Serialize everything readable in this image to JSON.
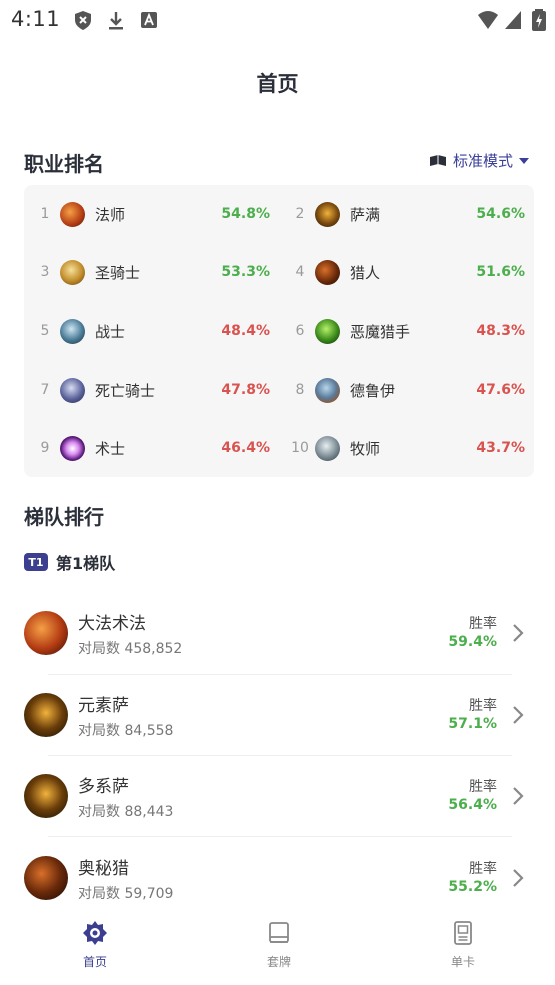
{
  "status_bar": {
    "time": "4:11"
  },
  "header": {
    "title": "首页"
  },
  "class_ranking": {
    "title": "职业排名",
    "mode_label": "标准模式",
    "items": [
      {
        "rank": "1",
        "name": "法师",
        "win_rate": "54.8%",
        "trend": "green"
      },
      {
        "rank": "2",
        "name": "萨满",
        "win_rate": "54.6%",
        "trend": "green"
      },
      {
        "rank": "3",
        "name": "圣骑士",
        "win_rate": "53.3%",
        "trend": "green"
      },
      {
        "rank": "4",
        "name": "猎人",
        "win_rate": "51.6%",
        "trend": "green"
      },
      {
        "rank": "5",
        "name": "战士",
        "win_rate": "48.4%",
        "trend": "red"
      },
      {
        "rank": "6",
        "name": "恶魔猎手",
        "win_rate": "48.3%",
        "trend": "red"
      },
      {
        "rank": "7",
        "name": "死亡骑士",
        "win_rate": "47.8%",
        "trend": "red"
      },
      {
        "rank": "8",
        "name": "德鲁伊",
        "win_rate": "47.6%",
        "trend": "red"
      },
      {
        "rank": "9",
        "name": "术士",
        "win_rate": "46.4%",
        "trend": "red"
      },
      {
        "rank": "10",
        "name": "牧师",
        "win_rate": "43.7%",
        "trend": "red"
      }
    ]
  },
  "ladder": {
    "title": "梯队排行",
    "tier_badge": "T1",
    "tier_label": "第1梯队",
    "decks": [
      {
        "name": "大法术法",
        "games": "对局数 458,852",
        "rate_label": "胜率",
        "rate": "59.4%"
      },
      {
        "name": "元素萨",
        "games": "对局数 84,558",
        "rate_label": "胜率",
        "rate": "57.1%"
      },
      {
        "name": "多系萨",
        "games": "对局数 88,443",
        "rate_label": "胜率",
        "rate": "56.4%"
      },
      {
        "name": "奥秘猎",
        "games": "对局数 59,709",
        "rate_label": "胜率",
        "rate": "55.2%"
      }
    ]
  },
  "bottom_nav": {
    "items": [
      {
        "label": "首页",
        "icon": "home-icon",
        "active": true
      },
      {
        "label": "套牌",
        "icon": "deck-icon",
        "active": false
      },
      {
        "label": "单卡",
        "icon": "card-icon",
        "active": false
      }
    ]
  },
  "colors": {
    "accent": "#3c3f8f",
    "positive": "#4cae4c",
    "negative": "#d9534f"
  }
}
